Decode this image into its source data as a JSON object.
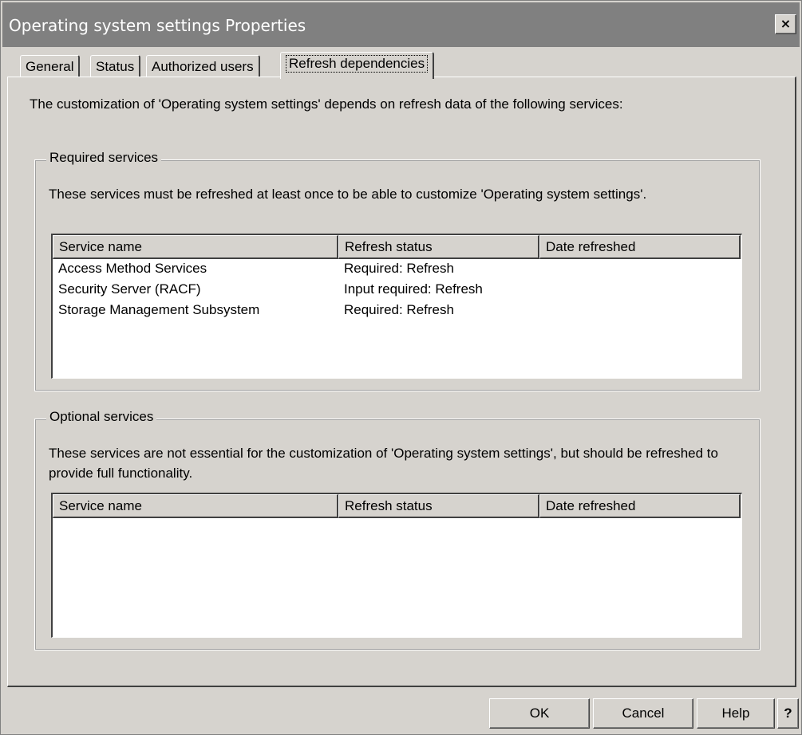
{
  "window": {
    "title": "Operating system settings Properties",
    "close_label": "×"
  },
  "tabs": [
    {
      "label": "General",
      "active": false
    },
    {
      "label": "Status",
      "active": false
    },
    {
      "label": "Authorized users",
      "active": false
    },
    {
      "label": "Refresh dependencies",
      "active": true
    }
  ],
  "intro": "The customization of 'Operating system settings' depends on refresh data of the following services:",
  "required": {
    "legend": "Required services",
    "description": "These services must be refreshed at least once to be able to customize 'Operating system settings'.",
    "columns": [
      "Service name",
      "Refresh status",
      "Date refreshed"
    ],
    "rows": [
      [
        "Access Method Services",
        "Required: Refresh",
        ""
      ],
      [
        "Security Server (RACF)",
        "Input required: Refresh",
        ""
      ],
      [
        "Storage Management Subsystem",
        "Required: Refresh",
        ""
      ]
    ]
  },
  "optional": {
    "legend": "Optional services",
    "description": "These services are not essential for the customization of 'Operating system settings', but should be refreshed to provide full functionality.",
    "columns": [
      "Service name",
      "Refresh status",
      "Date refreshed"
    ],
    "rows": []
  },
  "buttons": {
    "ok": "OK",
    "cancel": "Cancel",
    "help": "Help",
    "context_help": "?"
  }
}
